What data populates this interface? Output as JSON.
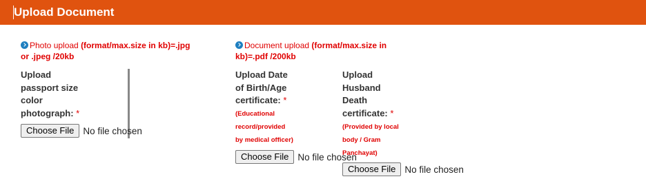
{
  "header": {
    "title": "Upload Document"
  },
  "photo": {
    "head_normal": "Photo upload ",
    "head_bold_1": "(format/max.size in kb)=.jpg",
    "head_bold_2": "or .jpeg /20kb",
    "label_lines": [
      "Upload",
      "passport size",
      "color",
      "photograph:"
    ],
    "required_mark": "*",
    "file_button": "Choose File",
    "file_status": "No file chosen"
  },
  "document": {
    "head_normal": "Document upload ",
    "head_bold_1": "(format/max.size in",
    "head_bold_2": "kb)=.pdf /200kb",
    "birth": {
      "label_lines": [
        "Upload Date",
        "of Birth/Age",
        "certificate:"
      ],
      "required_mark": "*",
      "note_lines": [
        "(Educational",
        "record/provided",
        "by medical officer)"
      ],
      "file_button": "Choose File",
      "file_status": "No file chosen"
    },
    "husband": {
      "label_lines": [
        "Upload",
        "Husband",
        "Death",
        "certificate:"
      ],
      "required_mark": "*",
      "note_lines": [
        "(Provided by local",
        "body / Gram",
        "Panchayat)"
      ],
      "file_button": "Choose File",
      "file_status": "No file chosen"
    }
  },
  "colors": {
    "header_bg": "#e0530f",
    "required": "#e00000",
    "info_icon": "#1e7fc0"
  }
}
